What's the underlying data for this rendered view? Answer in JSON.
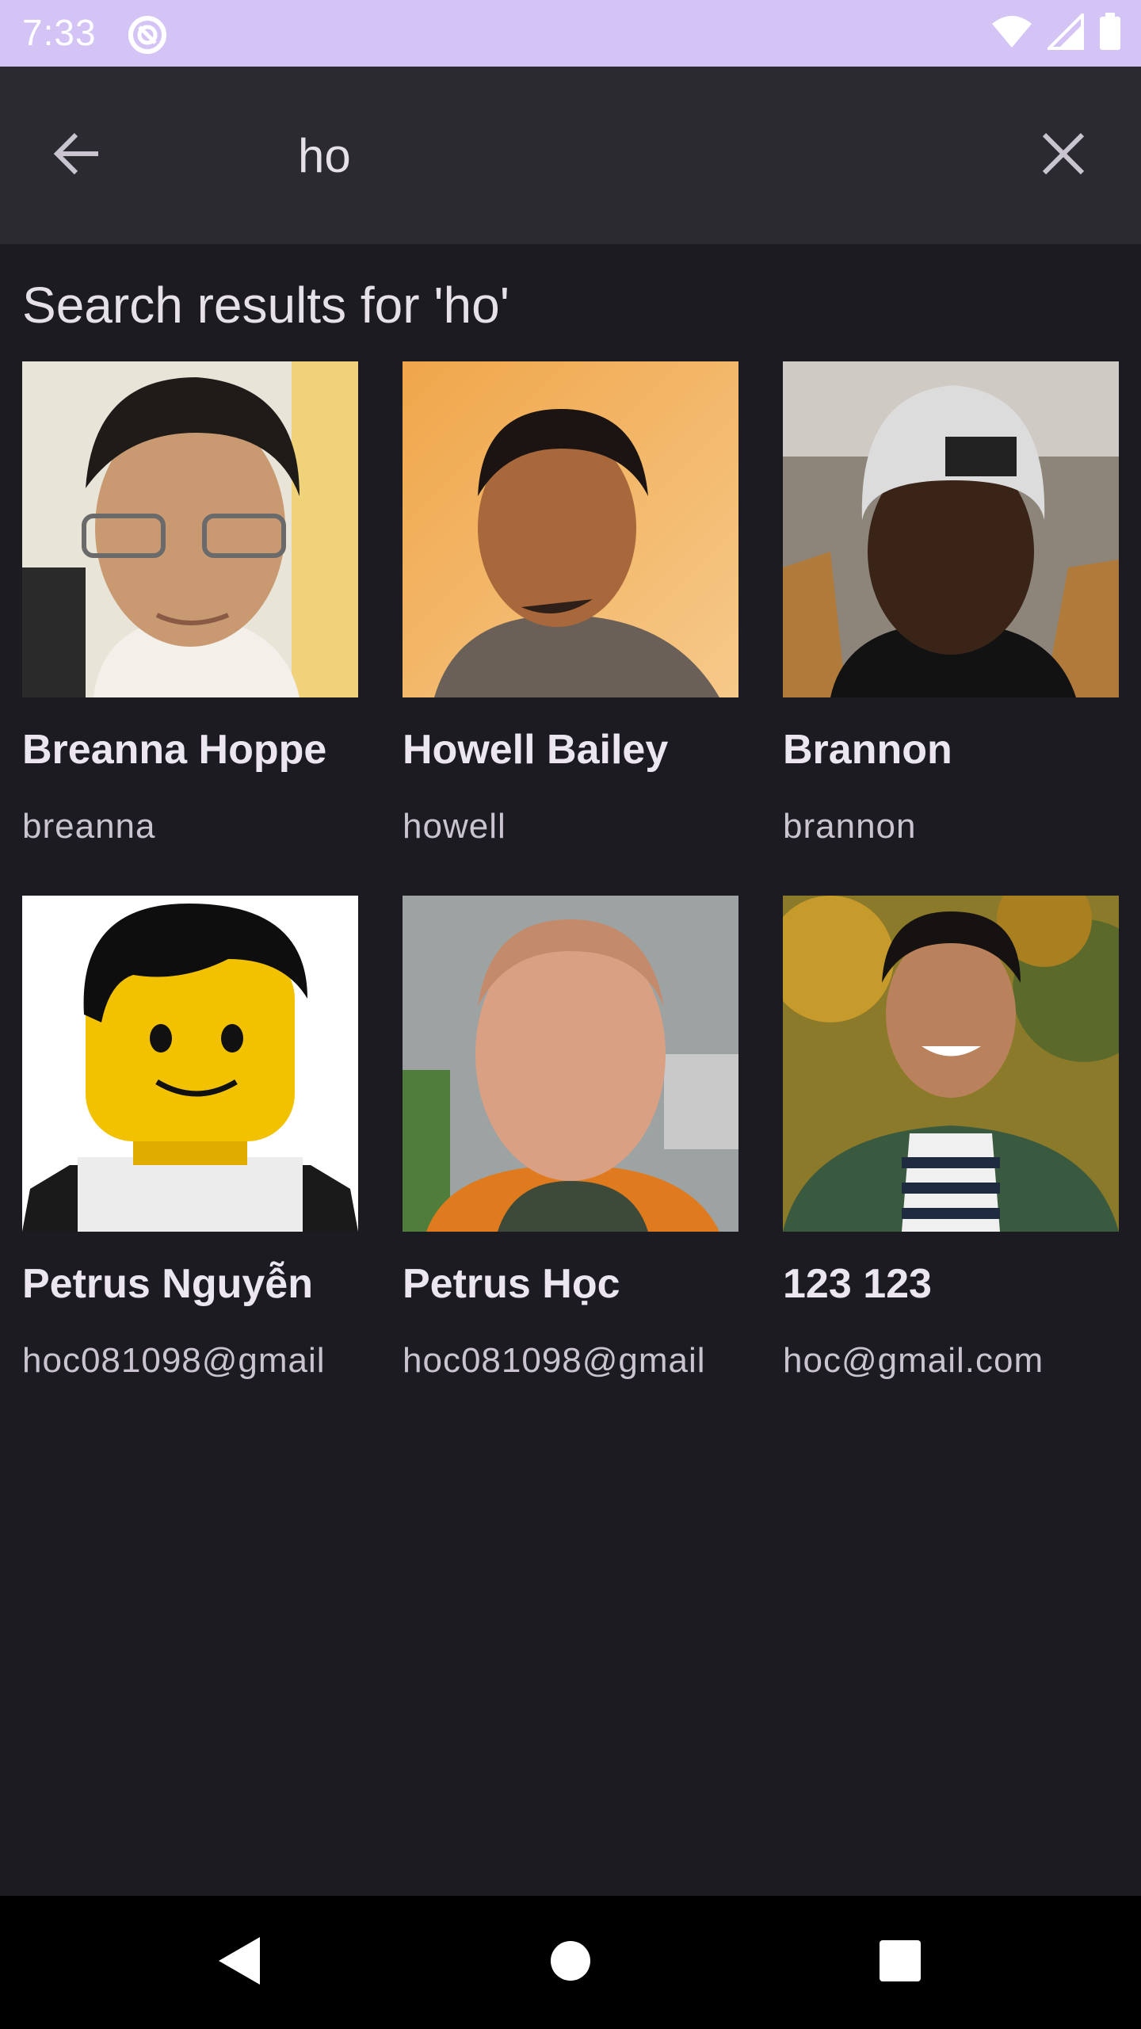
{
  "status_bar": {
    "time": "7:33",
    "icons": [
      "app-notification-icon",
      "wifi-icon",
      "signal-icon",
      "battery-icon"
    ]
  },
  "search": {
    "query": "ho",
    "back_icon": "arrow-back-icon",
    "clear_icon": "close-icon"
  },
  "results": {
    "title": "Search results for 'ho'",
    "items": [
      {
        "name": "Breanna Hoppe",
        "username": "breanna"
      },
      {
        "name": "Howell Bailey",
        "username": "howell"
      },
      {
        "name": "Brannon",
        "username": "brannon"
      },
      {
        "name": "Petrus Nguyễn",
        "username": "hoc081098@gmail"
      },
      {
        "name": "Petrus Học",
        "username": "hoc081098@gmail"
      },
      {
        "name": "123 123",
        "username": "hoc@gmail.com"
      }
    ]
  },
  "nav_bar": {
    "icons": [
      "nav-back-icon",
      "nav-home-icon",
      "nav-recents-icon"
    ]
  },
  "colors": {
    "status_bar": "#d4c3f5",
    "app_bar": "#2b2a31",
    "background": "#1c1b21",
    "text_primary": "#ece6f0",
    "text_secondary": "#c9c4cf"
  }
}
